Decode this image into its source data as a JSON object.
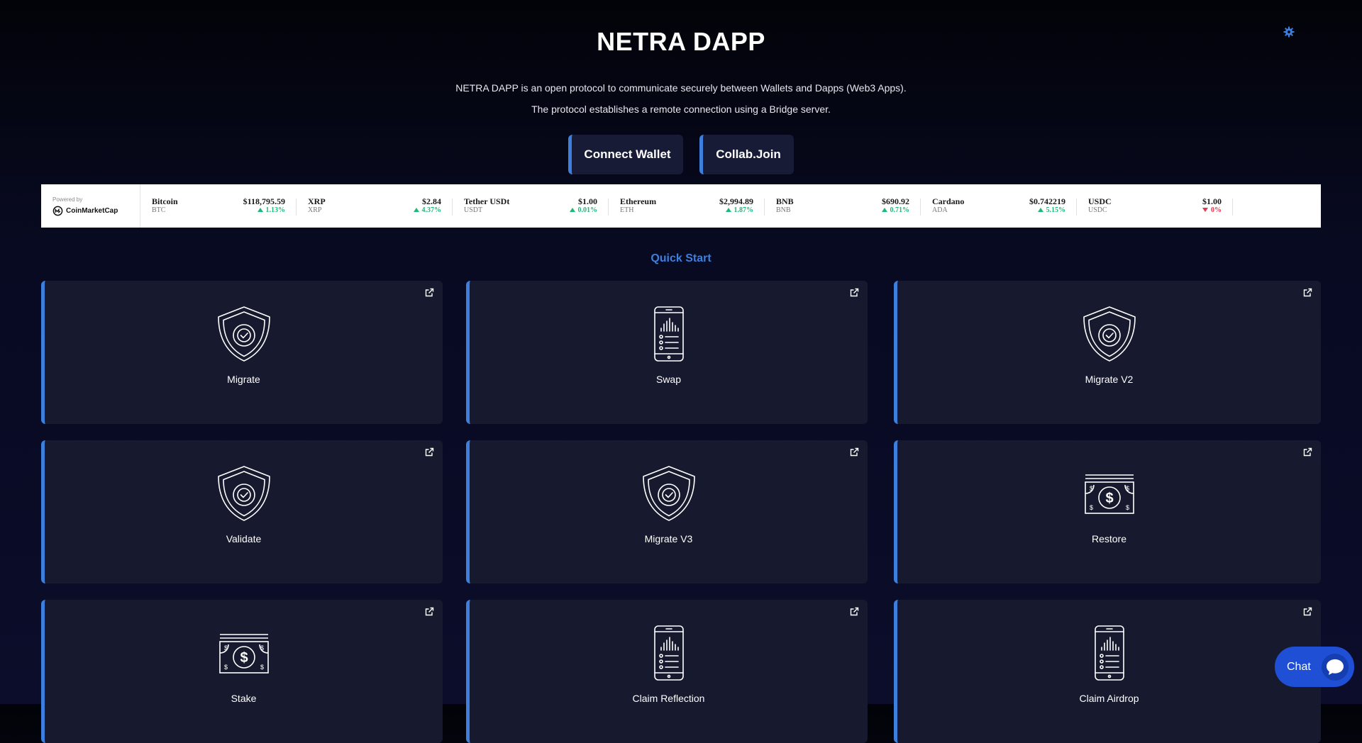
{
  "header": {
    "title": "NETRA DAPP",
    "description_line1": "NETRA DAPP is an open protocol to communicate securely between Wallets and Dapps (Web3 Apps).",
    "description_line2": "The protocol establishes a remote connection using a Bridge server.",
    "settings_icon": "gear-icon"
  },
  "actions": {
    "connect_wallet": "Connect Wallet",
    "collab_join": "Collab.Join"
  },
  "ticker": {
    "powered_by": "Powered by",
    "brand": "CoinMarketCap",
    "coins": [
      {
        "name": "Bitcoin",
        "symbol": "BTC",
        "price": "$118,795.59",
        "change": "1.13%",
        "direction": "up"
      },
      {
        "name": "XRP",
        "symbol": "XRP",
        "price": "$2.84",
        "change": "4.37%",
        "direction": "up"
      },
      {
        "name": "Tether USDt",
        "symbol": "USDT",
        "price": "$1.00",
        "change": "0.01%",
        "direction": "up"
      },
      {
        "name": "Ethereum",
        "symbol": "ETH",
        "price": "$2,994.89",
        "change": "1.87%",
        "direction": "up"
      },
      {
        "name": "BNB",
        "symbol": "BNB",
        "price": "$690.92",
        "change": "0.71%",
        "direction": "up"
      },
      {
        "name": "Cardano",
        "symbol": "ADA",
        "price": "$0.742219",
        "change": "5.15%",
        "direction": "up"
      },
      {
        "name": "USDC",
        "symbol": "USDC",
        "price": "$1.00",
        "change": "0%",
        "direction": "down"
      }
    ],
    "colors": {
      "up": "#1fb87a",
      "down": "#e03a4f"
    }
  },
  "quick_start": {
    "title": "Quick Start",
    "cards": [
      {
        "label": "Migrate",
        "icon": "shield-check-icon"
      },
      {
        "label": "Swap",
        "icon": "mobile-chart-icon"
      },
      {
        "label": "Migrate V2",
        "icon": "shield-check-icon"
      },
      {
        "label": "Validate",
        "icon": "shield-check-icon"
      },
      {
        "label": "Migrate V3",
        "icon": "shield-check-icon"
      },
      {
        "label": "Restore",
        "icon": "banknote-icon"
      },
      {
        "label": "Stake",
        "icon": "banknote-icon"
      },
      {
        "label": "Claim Reflection",
        "icon": "mobile-chart-icon"
      },
      {
        "label": "Claim Airdrop",
        "icon": "mobile-chart-icon"
      }
    ]
  },
  "chat": {
    "label": "Chat",
    "icon": "chat-bubble-icon"
  },
  "theme": {
    "accent": "#3d7fdc",
    "card_bg": "#171a2e",
    "chat_bg": "#1e4fd4"
  }
}
